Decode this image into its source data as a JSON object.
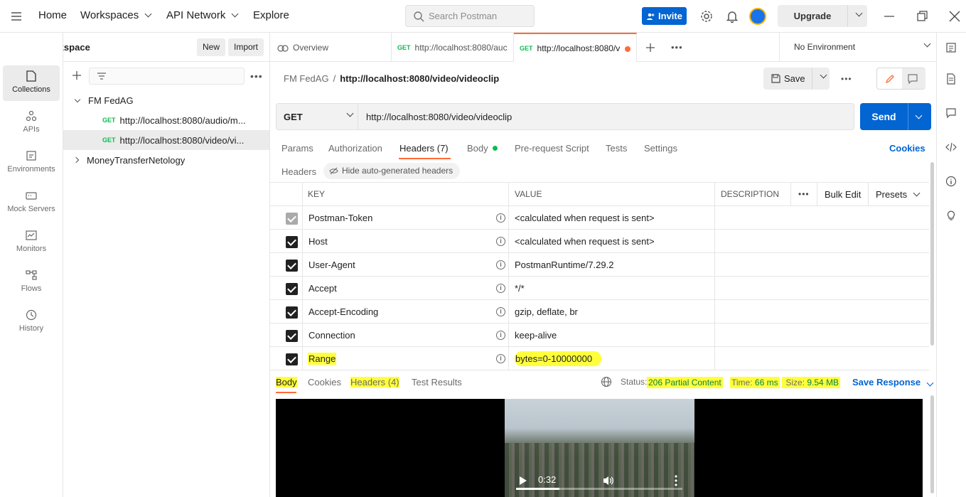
{
  "topbar": {
    "nav": [
      "Home",
      "Workspaces",
      "API Network",
      "Explore"
    ],
    "search_placeholder": "Search Postman",
    "invite": "Invite",
    "upgrade": "Upgrade"
  },
  "workspace": {
    "title": "My Workspace",
    "new_label": "New",
    "import_label": "Import"
  },
  "rail": {
    "items": [
      "Collections",
      "APIs",
      "Environments",
      "Mock Servers",
      "Monitors",
      "Flows",
      "History"
    ]
  },
  "collections": {
    "groups": [
      {
        "name": "FM FedAG",
        "requests": [
          {
            "method": "GET",
            "url": "http://localhost:8080/audio/m..."
          },
          {
            "method": "GET",
            "url": "http://localhost:8080/video/vi..."
          }
        ]
      },
      {
        "name": "MoneyTransferNetology"
      }
    ]
  },
  "tabs": {
    "overview": "Overview",
    "tab1": {
      "method": "GET",
      "url": "http://localhost:8080/auc"
    },
    "tab2": {
      "method": "GET",
      "url": "http://localhost:8080/v"
    },
    "environment": "No Environment"
  },
  "request": {
    "breadcrumb_parent": "FM FedAG",
    "breadcrumb_sep": "/",
    "breadcrumb_current": "http://localhost:8080/video/videoclip",
    "save": "Save",
    "method": "GET",
    "url": "http://localhost:8080/video/videoclip",
    "send": "Send",
    "tabs": [
      "Params",
      "Authorization",
      "Headers (7)",
      "Body",
      "Pre-request Script",
      "Tests",
      "Settings"
    ],
    "cookies": "Cookies",
    "headers_label": "Headers",
    "hide_auto": "Hide auto-generated headers"
  },
  "headers_table": {
    "columns": [
      "KEY",
      "VALUE",
      "DESCRIPTION",
      "Bulk Edit",
      "Presets"
    ],
    "rows": [
      {
        "key": "Postman-Token",
        "value": "<calculated when request is sent>"
      },
      {
        "key": "Host",
        "value": "<calculated when request is sent>"
      },
      {
        "key": "User-Agent",
        "value": "PostmanRuntime/7.29.2"
      },
      {
        "key": "Accept",
        "value": "*/*"
      },
      {
        "key": "Accept-Encoding",
        "value": "gzip, deflate, br"
      },
      {
        "key": "Connection",
        "value": "keep-alive"
      },
      {
        "key": "Range",
        "value": "bytes=0-10000000"
      }
    ]
  },
  "response": {
    "tabs": [
      "Body",
      "Cookies",
      "Headers (4)",
      "Test Results"
    ],
    "status_label": "Status:",
    "status_value": "206 Partial Content",
    "time_label": "Time:",
    "time_value": "66 ms",
    "size_label": "Size:",
    "size_value": "9.54 MB",
    "save_response": "Save Response",
    "video_time": "0:32",
    "video_progress": 0.26
  },
  "colors": {
    "accent": "#ff6c37",
    "primary": "#0265d2",
    "highlight": "#ffff3b"
  }
}
